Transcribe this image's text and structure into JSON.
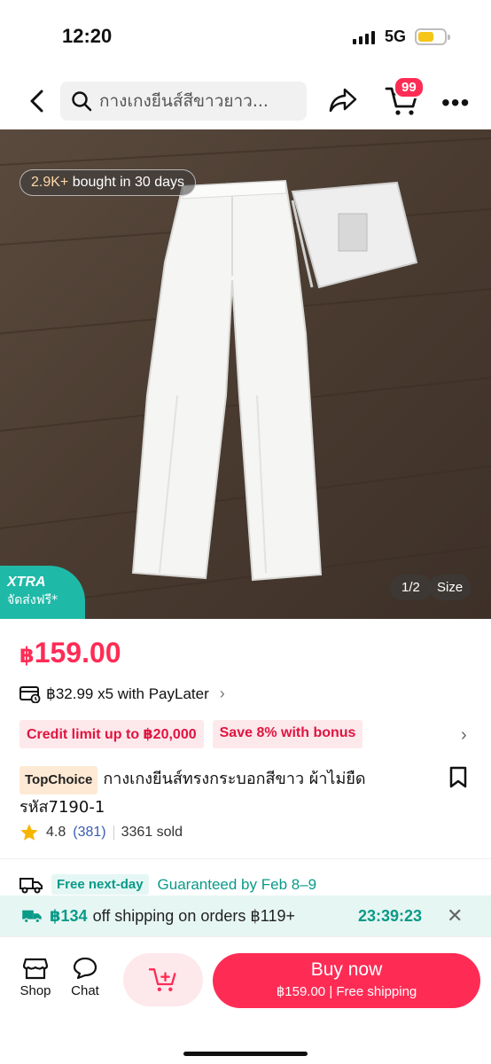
{
  "status_bar": {
    "time": "12:20",
    "network": "5G"
  },
  "nav": {
    "search_text": "กางเกงยีนส์สีขาวยาว...",
    "cart_count": "99"
  },
  "gallery": {
    "bought_count": "2.9K+",
    "bought_text": "bought in 30 days",
    "xtra_title": "XTRA",
    "xtra_subtitle": "จัดส่งฟรี*",
    "pager": "1/2",
    "size_label": "Size"
  },
  "product": {
    "currency": "฿",
    "price": "159.00",
    "paylater": "฿32.99 x5 with PayLater",
    "promos": [
      "Credit limit up to ฿20,000",
      "Save 8% with bonus"
    ],
    "badge": "TopChoice",
    "title": "กางเกงยีนส์ทรงกระบอกสีขาว ผ้าไม่ยืด รหัส7190-1",
    "rating": "4.8",
    "review_count": "(381)",
    "sold": "3361 sold"
  },
  "delivery": {
    "tag": "Free next-day",
    "guarantee": "Guaranteed by Feb 8–9"
  },
  "shipping_banner": {
    "amount": "฿134",
    "text": "off shipping on orders ฿119+",
    "timer": "23:39:23"
  },
  "bottom_bar": {
    "shop_label": "Shop",
    "chat_label": "Chat",
    "buy_label": "Buy now",
    "buy_price": "฿159.00",
    "buy_shipping": "Free shipping"
  },
  "colors": {
    "accent": "#fe2c55",
    "teal": "#0a9a88",
    "xtra": "#1fb9a8"
  }
}
